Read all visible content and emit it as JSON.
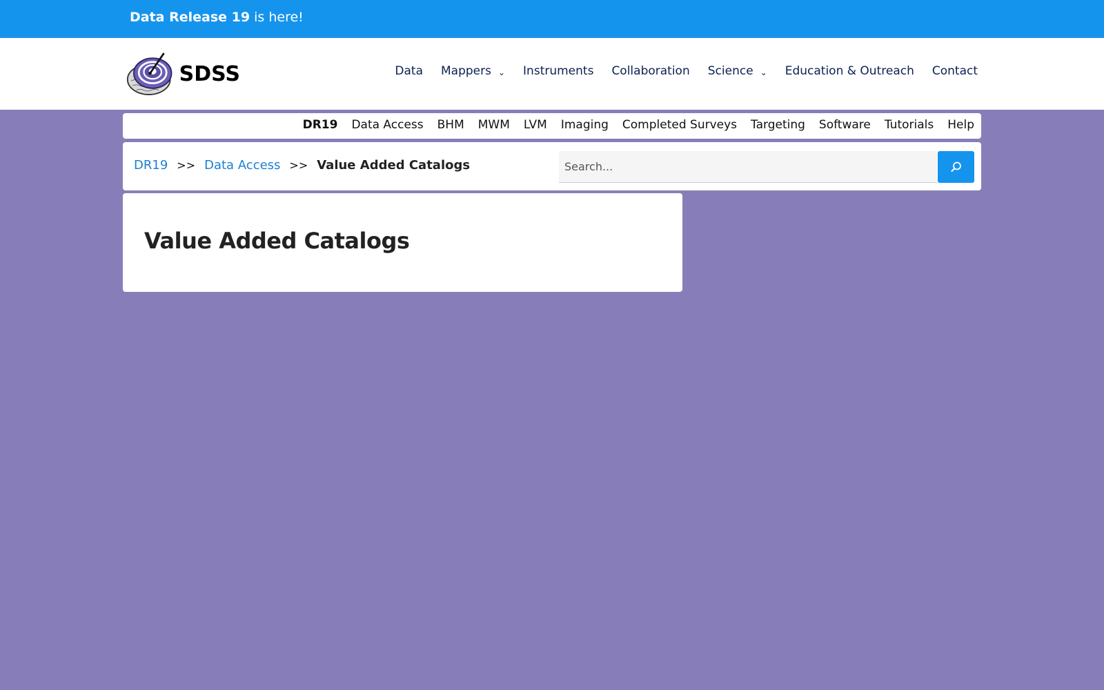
{
  "announcement": {
    "bold": "Data Release 19",
    "rest": " is here!"
  },
  "brand": {
    "name": "SDSS",
    "accent": "#6b5fb5"
  },
  "main_nav": {
    "items": [
      {
        "label": "Data",
        "has_dropdown": false
      },
      {
        "label": "Mappers",
        "has_dropdown": true
      },
      {
        "label": "Instruments",
        "has_dropdown": false
      },
      {
        "label": "Collaboration",
        "has_dropdown": false
      },
      {
        "label": "Science",
        "has_dropdown": true
      },
      {
        "label": "Education & Outreach",
        "has_dropdown": false
      },
      {
        "label": "Contact",
        "has_dropdown": false
      }
    ]
  },
  "sub_nav": {
    "items": [
      {
        "label": "DR19",
        "active": true
      },
      {
        "label": "Data Access",
        "active": false
      },
      {
        "label": "BHM",
        "active": false
      },
      {
        "label": "MWM",
        "active": false
      },
      {
        "label": "LVM",
        "active": false
      },
      {
        "label": "Imaging",
        "active": false
      },
      {
        "label": "Completed Surveys",
        "active": false
      },
      {
        "label": "Targeting",
        "active": false
      },
      {
        "label": "Software",
        "active": false
      },
      {
        "label": "Tutorials",
        "active": false
      },
      {
        "label": "Help",
        "active": false
      }
    ]
  },
  "breadcrumb": {
    "items": [
      "DR19",
      "Data Access"
    ],
    "separator": ">>",
    "current": "Value Added Catalogs"
  },
  "search": {
    "placeholder": "Search...",
    "value": "",
    "button_icon": "search-icon"
  },
  "page": {
    "title": "Value Added Catalogs"
  },
  "colors": {
    "announce_bg": "#1594ee",
    "page_bg": "#877eb9",
    "nav_text": "#0b2151",
    "link": "#1a7fd4"
  }
}
